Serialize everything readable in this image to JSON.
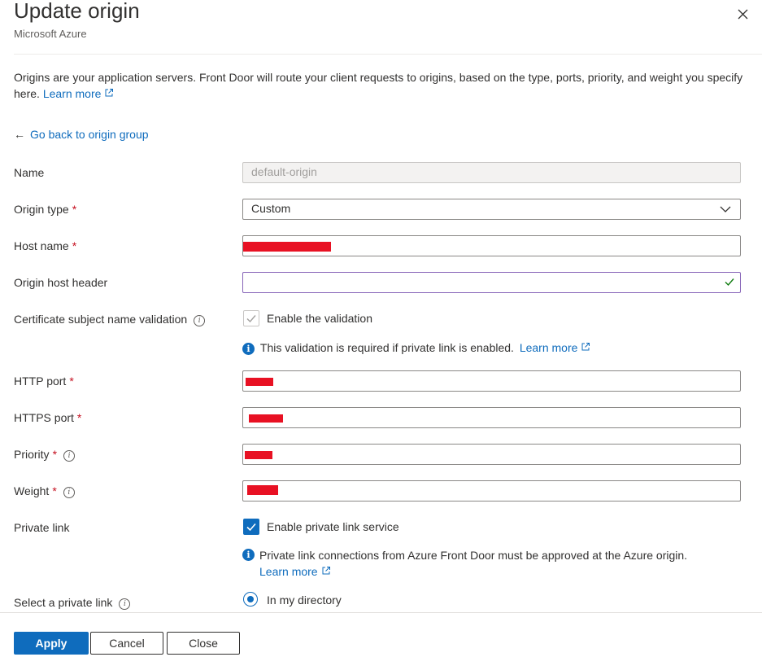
{
  "header": {
    "title": "Update origin",
    "subtitle": "Microsoft Azure"
  },
  "description": {
    "text": "Origins are your application servers. Front Door will route your client requests to origins, based on the type, ports, priority, and weight you specify here.",
    "link": "Learn more"
  },
  "back_link": "Go back to origin group",
  "form": {
    "name": {
      "label": "Name",
      "value": "default-origin"
    },
    "origin_type": {
      "label": "Origin type",
      "required_mark": "*",
      "value": "Custom"
    },
    "host_name": {
      "label": "Host name",
      "required_mark": "*"
    },
    "origin_host_header": {
      "label": "Origin host header",
      "value": ""
    },
    "cert_validation": {
      "label": "Certificate subject name validation",
      "checkbox_label": "Enable the validation",
      "checked": true,
      "info_text": "This validation is required if private link is enabled.",
      "info_link": "Learn more"
    },
    "http_port": {
      "label": "HTTP port",
      "required_mark": "*"
    },
    "https_port": {
      "label": "HTTPS port",
      "required_mark": "*"
    },
    "priority": {
      "label": "Priority",
      "required_mark": "*"
    },
    "weight": {
      "label": "Weight",
      "required_mark": "*"
    },
    "private_link": {
      "label": "Private link",
      "checkbox_label": "Enable private link service",
      "checked": true,
      "info_text": "Private link connections from Azure Front Door must be approved at the Azure origin.",
      "info_link": "Learn more"
    },
    "select_private_link": {
      "label": "Select a private link",
      "radio_label": "In my directory",
      "selected": true
    }
  },
  "footer": {
    "apply": "Apply",
    "cancel": "Cancel",
    "close": "Close"
  },
  "colors": {
    "accent": "#0f6cbd",
    "required": "#c50f1f",
    "redaction": "#e81123"
  }
}
